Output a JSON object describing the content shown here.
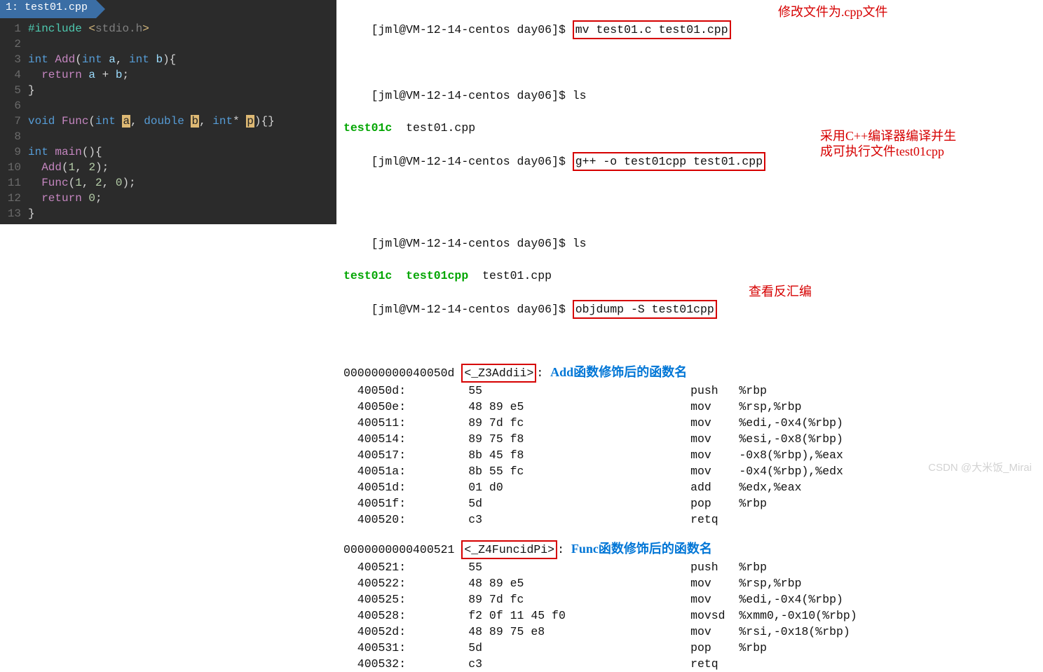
{
  "editor": {
    "tab": "1: test01.cpp",
    "lines": [
      {
        "n": 1,
        "segs": [
          [
            "#include ",
            "include"
          ],
          [
            "<",
            "bracket"
          ],
          [
            "stdio.h",
            "header"
          ],
          [
            ">",
            "bracket"
          ]
        ]
      },
      {
        "n": 2,
        "segs": []
      },
      {
        "n": 3,
        "segs": [
          [
            "int ",
            "type"
          ],
          [
            "Add",
            "func"
          ],
          [
            "(",
            "punc"
          ],
          [
            "int ",
            "type"
          ],
          [
            "a",
            "var"
          ],
          [
            ", ",
            "punc"
          ],
          [
            "int ",
            "type"
          ],
          [
            "b",
            "var"
          ],
          [
            "){",
            "punc"
          ]
        ]
      },
      {
        "n": 4,
        "segs": [
          [
            "  ",
            "plain"
          ],
          [
            "return ",
            "keyword"
          ],
          [
            "a ",
            "var"
          ],
          [
            "+ ",
            "punc"
          ],
          [
            "b",
            "var"
          ],
          [
            ";",
            "punc"
          ]
        ]
      },
      {
        "n": 5,
        "segs": [
          [
            "}",
            "punc"
          ]
        ]
      },
      {
        "n": 6,
        "segs": []
      },
      {
        "n": 7,
        "segs": [
          [
            "void ",
            "type"
          ],
          [
            "Func",
            "func"
          ],
          [
            "(",
            "punc"
          ],
          [
            "int ",
            "type"
          ],
          [
            "a",
            "hl"
          ],
          [
            ", ",
            "punc"
          ],
          [
            "double ",
            "type"
          ],
          [
            "b",
            "hl"
          ],
          [
            ", ",
            "punc"
          ],
          [
            "int",
            "type"
          ],
          [
            "* ",
            "punc"
          ],
          [
            "p",
            "hl"
          ],
          [
            "){}",
            "punc"
          ]
        ]
      },
      {
        "n": 8,
        "segs": []
      },
      {
        "n": 9,
        "segs": [
          [
            "int ",
            "type"
          ],
          [
            "main",
            "func"
          ],
          [
            "(){",
            "punc"
          ]
        ]
      },
      {
        "n": 10,
        "segs": [
          [
            "  ",
            "plain"
          ],
          [
            "Add",
            "func"
          ],
          [
            "(",
            "punc"
          ],
          [
            "1",
            "num"
          ],
          [
            ", ",
            "punc"
          ],
          [
            "2",
            "num"
          ],
          [
            ");",
            "punc"
          ]
        ]
      },
      {
        "n": 11,
        "segs": [
          [
            "  ",
            "plain"
          ],
          [
            "Func",
            "func"
          ],
          [
            "(",
            "punc"
          ],
          [
            "1",
            "num"
          ],
          [
            ", ",
            "punc"
          ],
          [
            "2",
            "num"
          ],
          [
            ", ",
            "punc"
          ],
          [
            "0",
            "num"
          ],
          [
            ");",
            "punc"
          ]
        ]
      },
      {
        "n": 12,
        "segs": [
          [
            "  ",
            "plain"
          ],
          [
            "return ",
            "keyword"
          ],
          [
            "0",
            "num"
          ],
          [
            ";",
            "punc"
          ]
        ]
      },
      {
        "n": 13,
        "segs": [
          [
            "}",
            "punc"
          ]
        ]
      }
    ]
  },
  "terminal": {
    "prompt": "[jml@VM-12-14-centos day06]$ ",
    "cmd_mv": "mv test01.c test01.cpp",
    "annot_mv": "修改文件为.cpp文件",
    "cmd_ls": "ls",
    "ls1_a": "test01c",
    "ls1_b": "  test01.cpp",
    "cmd_gpp": "g++ -o test01cpp test01.cpp",
    "annot_gpp_l1": "采用C++编译器编译并生",
    "annot_gpp_l2": "成可执行文件test01cpp",
    "ls2_a": "test01c",
    "ls2_b": "  ",
    "ls2_c": "test01cpp",
    "ls2_d": "  test01.cpp",
    "cmd_objdump": "objdump -S test01cpp",
    "annot_objdump": "查看反汇编",
    "sym1_addr": "000000000040050d ",
    "sym1_name": "<_Z3Addii>",
    "sym1_colon": ":",
    "annot_sym1": "Add函数修饰后的函数名",
    "sym2_addr": "0000000000400521 ",
    "sym2_name": "<_Z4FuncidPi>",
    "sym2_colon": ":",
    "annot_sym2": "Func函数修饰后的函数名",
    "asm1": [
      [
        "  40050d:",
        "55",
        "push",
        "%rbp"
      ],
      [
        "  40050e:",
        "48 89 e5",
        "mov",
        "%rsp,%rbp"
      ],
      [
        "  400511:",
        "89 7d fc",
        "mov",
        "%edi,-0x4(%rbp)"
      ],
      [
        "  400514:",
        "89 75 f8",
        "mov",
        "%esi,-0x8(%rbp)"
      ],
      [
        "  400517:",
        "8b 45 f8",
        "mov",
        "-0x8(%rbp),%eax"
      ],
      [
        "  40051a:",
        "8b 55 fc",
        "mov",
        "-0x4(%rbp),%edx"
      ],
      [
        "  40051d:",
        "01 d0",
        "add",
        "%edx,%eax"
      ],
      [
        "  40051f:",
        "5d",
        "pop",
        "%rbp"
      ],
      [
        "  400520:",
        "c3",
        "retq",
        ""
      ]
    ],
    "asm2": [
      [
        "  400521:",
        "55",
        "push",
        "%rbp"
      ],
      [
        "  400522:",
        "48 89 e5",
        "mov",
        "%rsp,%rbp"
      ],
      [
        "  400525:",
        "89 7d fc",
        "mov",
        "%edi,-0x4(%rbp)"
      ],
      [
        "  400528:",
        "f2 0f 11 45 f0",
        "movsd",
        "%xmm0,-0x10(%rbp)"
      ],
      [
        "  40052d:",
        "48 89 75 e8",
        "mov",
        "%rsi,-0x18(%rbp)"
      ],
      [
        "  400531:",
        "5d",
        "pop",
        "%rbp"
      ],
      [
        "  400532:",
        "c3",
        "retq",
        ""
      ]
    ]
  },
  "watermark": "CSDN @大米饭_Mirai"
}
